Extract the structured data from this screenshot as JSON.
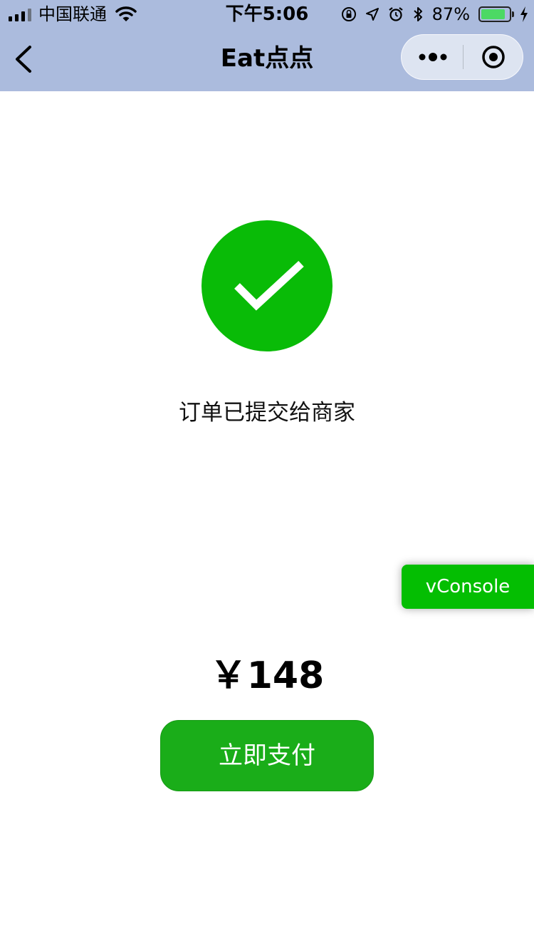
{
  "status_bar": {
    "carrier": "中国联通",
    "time": "下午5:06",
    "battery_percent": "87%",
    "battery_level": 0.87,
    "icons": [
      "signal-icon",
      "wifi-icon",
      "orientation-lock-icon",
      "location-icon",
      "alarm-icon",
      "bluetooth-icon",
      "battery-icon",
      "charging-icon"
    ]
  },
  "nav": {
    "title": "Eat点点",
    "back_icon": "chevron-left-icon",
    "capsule_icons": [
      "more-icon",
      "close-target-icon"
    ]
  },
  "result": {
    "icon": "checkmark-circle-icon",
    "message": "订单已提交给商家"
  },
  "order": {
    "price": "￥148"
  },
  "actions": {
    "pay_label": "立即支付"
  },
  "debug": {
    "vconsole_label": "vConsole"
  },
  "colors": {
    "nav_background": "#abbbdd",
    "success_green": "#09bb07",
    "pay_button_green": "#1aad19",
    "vconsole_green": "#04be02",
    "battery_green": "#4cd964"
  }
}
